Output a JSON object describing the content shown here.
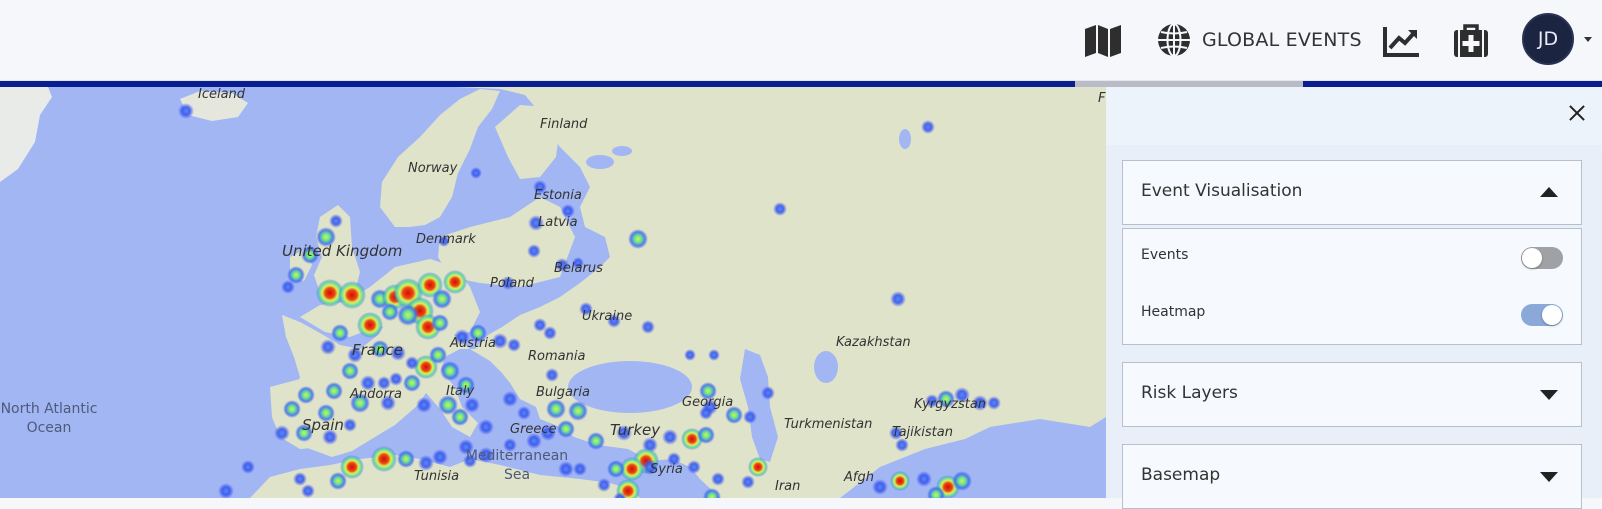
{
  "header": {
    "global_events_label": "GLOBAL EVENTS",
    "user_initials": "JD",
    "icons": [
      "map-icon",
      "globe-icon",
      "trend-chart-icon",
      "medical-kit-icon",
      "caret-down-icon"
    ]
  },
  "map": {
    "labels": {
      "iceland": "Iceland",
      "finland": "Finland",
      "norway": "Norway",
      "estonia": "Estonia",
      "latvia": "Latvia",
      "united_kingdom": "United Kingdom",
      "denmark": "Denmark",
      "belarus": "Belarus",
      "poland": "Poland",
      "ukraine": "Ukraine",
      "kazakhstan": "Kazakhstan",
      "france": "France",
      "austria": "Austria",
      "romania": "Romania",
      "bulgaria": "Bulgaria",
      "andorra": "Andorra",
      "italy": "Italy",
      "georgia": "Georgia",
      "kyrgyzstan": "Kyrgyzstan",
      "north_atlantic_ocean": "North Atlantic Ocean",
      "spain": "Spain",
      "greece": "Greece",
      "turkey": "Turkey",
      "turkmenistan": "Turkmenistan",
      "tajikistan": "Tajikistan",
      "mediterranean_sea": "Mediterranean Sea",
      "tunisia": "Tunisia",
      "syria": "Syria",
      "iran": "Iran",
      "afghanistan": "Afgh",
      "edge_letter": "F"
    },
    "colors": {
      "water": "#a2b6f4",
      "land": "#dfe3c9",
      "heat_low": "#3c55f0",
      "heat_mid": "#8de060",
      "heat_high": "#d80a0a"
    }
  },
  "panel": {
    "event_visualisation": {
      "title": "Event Visualisation",
      "expanded": true,
      "events_label": "Events",
      "events_on": false,
      "heatmap_label": "Heatmap",
      "heatmap_on": true
    },
    "risk_layers": {
      "title": "Risk Layers",
      "expanded": false
    },
    "basemap": {
      "title": "Basemap",
      "expanded": false
    }
  }
}
